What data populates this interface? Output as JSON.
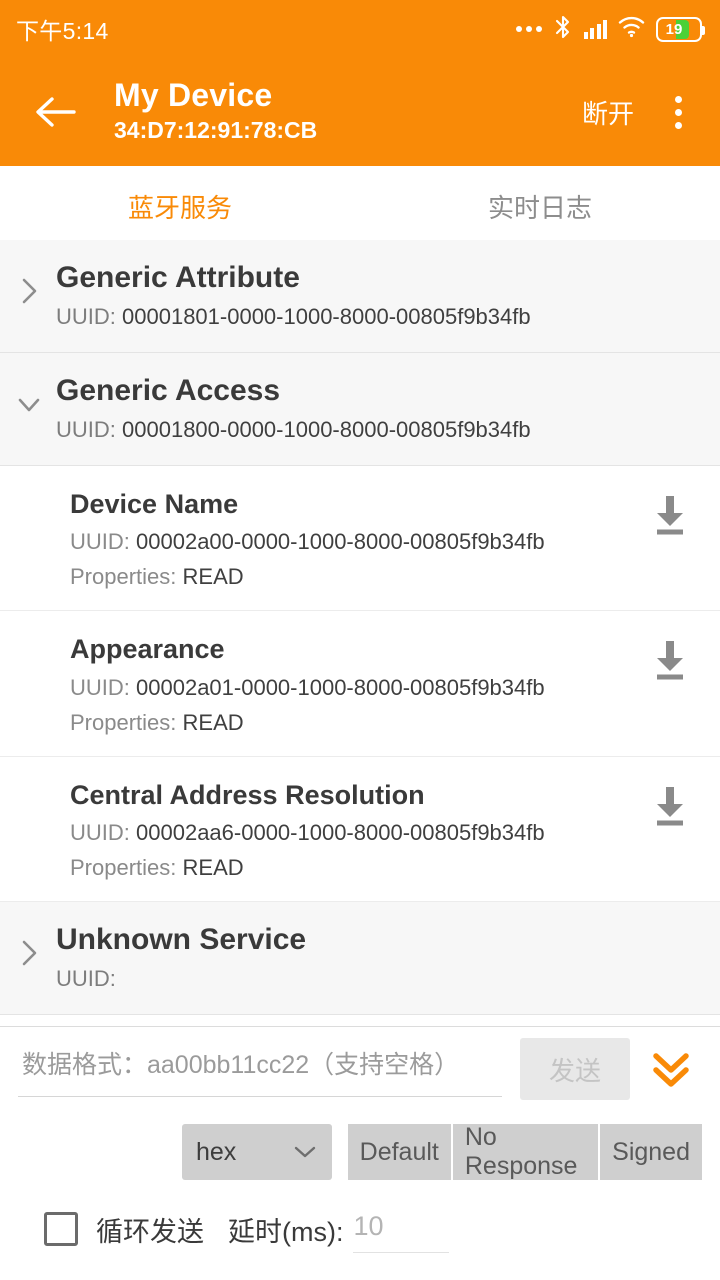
{
  "colors": {
    "accent": "#F98A07",
    "battery_fill": "#4CD137",
    "service_bg": "#f7f7f7"
  },
  "statusbar": {
    "time": "下午5:14",
    "battery_level": "19",
    "icons": [
      "more-dots-icon",
      "bluetooth-icon",
      "cellular-signal-icon",
      "wifi-icon",
      "battery-icon"
    ]
  },
  "appbar": {
    "back_icon": "back-arrow-icon",
    "title": "My Device",
    "subtitle": "34:D7:12:91:78:CB",
    "action_label": "断开",
    "overflow_icon": "kebab-menu-icon"
  },
  "tabs": [
    {
      "label": "蓝牙服务",
      "active": true
    },
    {
      "label": "实时日志",
      "active": false
    }
  ],
  "uuid_label": "UUID:",
  "properties_label": "Properties:",
  "services": [
    {
      "name": "Generic Attribute",
      "uuid": "00001801-0000-1000-8000-00805f9b34fb",
      "expanded": false,
      "chevron": "chevron-right-icon",
      "characteristics": []
    },
    {
      "name": "Generic Access",
      "uuid": "00001800-0000-1000-8000-00805f9b34fb",
      "expanded": true,
      "chevron": "chevron-down-icon",
      "characteristics": [
        {
          "name": "Device Name",
          "uuid": "00002a00-0000-1000-8000-00805f9b34fb",
          "properties": "READ",
          "action_icon": "download-read-icon"
        },
        {
          "name": "Appearance",
          "uuid": "00002a01-0000-1000-8000-00805f9b34fb",
          "properties": "READ",
          "action_icon": "download-read-icon"
        },
        {
          "name": "Central Address Resolution",
          "uuid": "00002aa6-0000-1000-8000-00805f9b34fb",
          "properties": "READ",
          "action_icon": "download-read-icon"
        }
      ]
    },
    {
      "name": "Unknown Service",
      "uuid": "",
      "expanded": false,
      "chevron": "chevron-right-icon",
      "characteristics": []
    }
  ],
  "bottom_panel": {
    "data_input_placeholder": "数据格式：aa00bb11cc22（支持空格）",
    "data_input_value": "",
    "send_label": "发送",
    "send_disabled": true,
    "collapse_icon": "double-chevron-down-icon",
    "format_select": {
      "value": "hex",
      "chevron": "chevron-down-icon"
    },
    "write_modes": [
      "Default",
      "No Response",
      "Signed"
    ],
    "loop_send_label": "循环发送",
    "loop_send_checked": false,
    "delay_label": "延时(ms):",
    "delay_placeholder": "10",
    "delay_value": ""
  }
}
